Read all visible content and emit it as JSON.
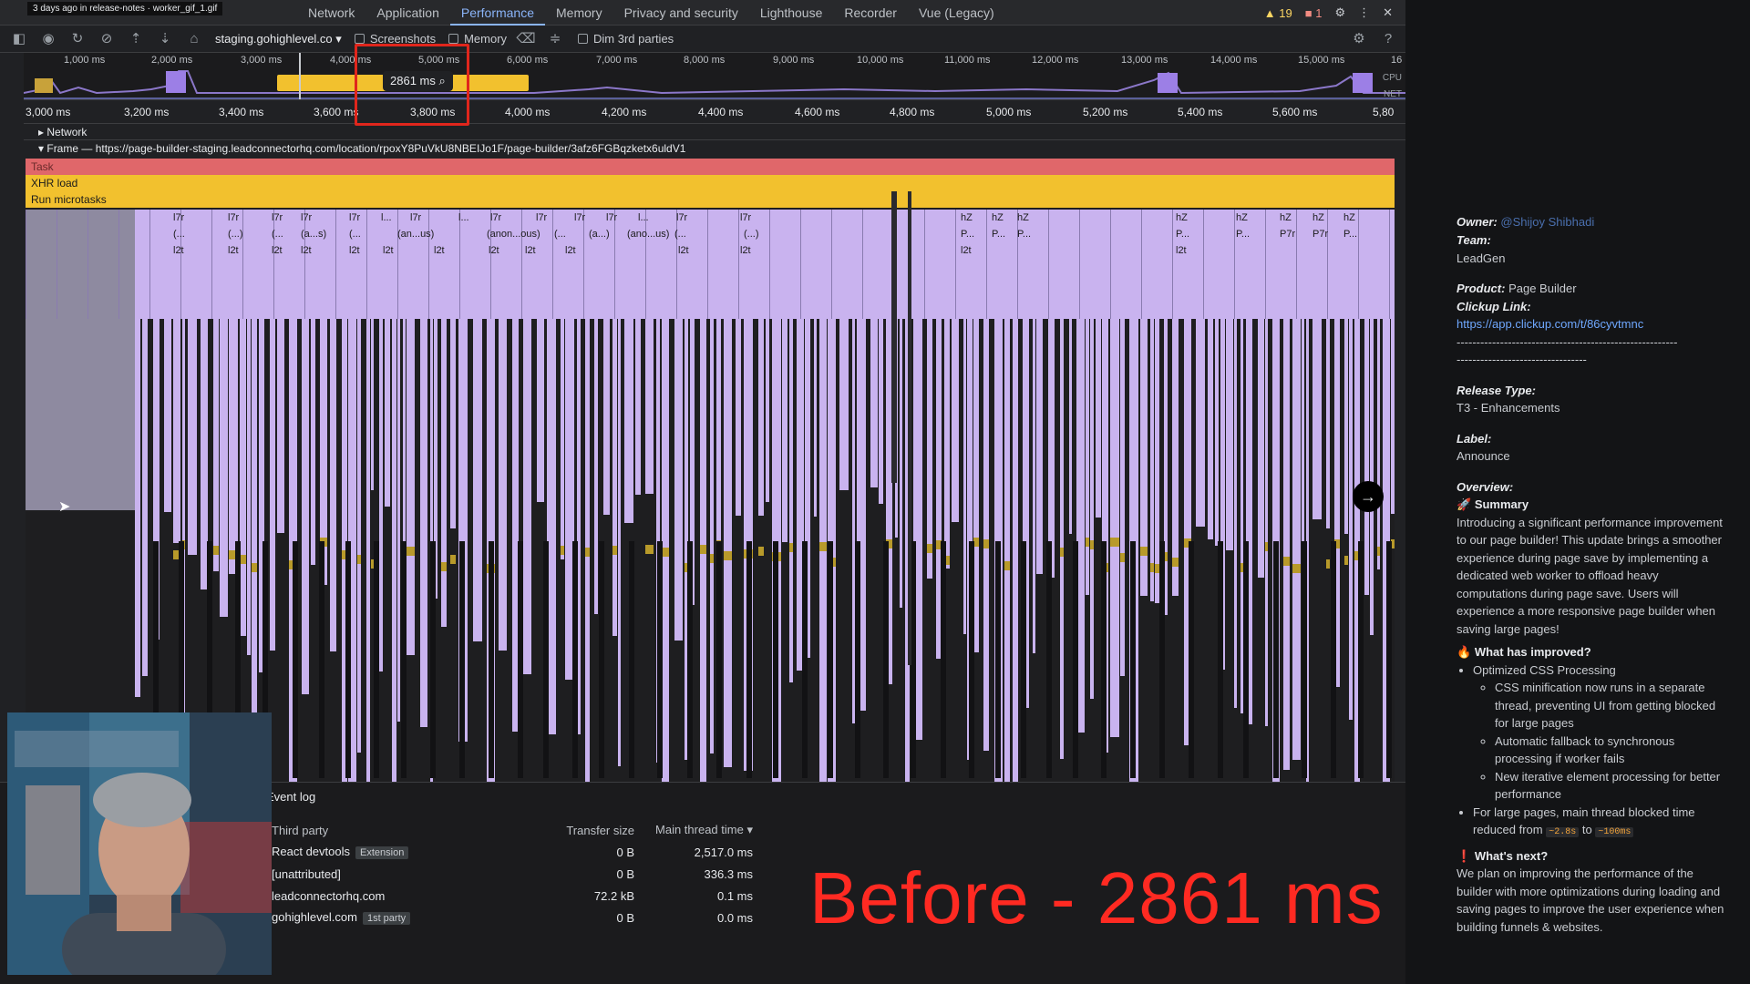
{
  "tabbar": {
    "ghost_label": "3 days ago in release-notes · worker_gif_1.gif",
    "tabs": [
      "Network",
      "Application",
      "Performance",
      "Memory",
      "Privacy and security",
      "Lighthouse",
      "Recorder",
      "Vue (Legacy)"
    ],
    "active_tab": "Performance",
    "warnings": "19",
    "errors": "1"
  },
  "toolbar": {
    "url": "staging.gohighlevel.co",
    "screenshots_label": "Screenshots",
    "memory_label": "Memory",
    "dim_label": "Dim 3rd parties"
  },
  "overview": {
    "ticks": [
      "1,000 ms",
      "2,000 ms",
      "3,000 ms",
      "4,000 ms",
      "5,000 ms",
      "6,000 ms",
      "7,000 ms",
      "8,000 ms",
      "9,000 ms",
      "10,000 ms",
      "11,000 ms",
      "12,000 ms",
      "13,000 ms",
      "14,000 ms",
      "15,000 ms",
      "16"
    ],
    "selection_label": "2861 ms",
    "cpu_label": "CPU",
    "net_label": "NET"
  },
  "ruler": {
    "ticks": [
      "3,000 ms",
      "3,200 ms",
      "3,400 ms",
      "3,600 ms",
      "3,800 ms",
      "4,000 ms",
      "4,200 ms",
      "4,400 ms",
      "4,600 ms",
      "4,800 ms",
      "5,000 ms",
      "5,200 ms",
      "5,400 ms",
      "5,600 ms",
      "5,80"
    ]
  },
  "tracks": {
    "network_label": "Network",
    "frame_label": "Frame — https://page-builder-staging.leadconnectorhq.com/location/rpoxY8PuVkU8NBEIJo1F/page-builder/3afz6FGBqzketx6uldV1",
    "task_label": "Task",
    "xhr_label": "XHR load",
    "microtasks_label": "Run microtasks"
  },
  "flame_labels": {
    "row1": [
      "l7r",
      "l7r",
      "l7r",
      "l7r",
      "l7r",
      "l...",
      "l7r",
      "l...",
      "l7r",
      "l7r",
      "l7r",
      "l7r",
      "l...",
      "l7r",
      "l7r",
      "hZ",
      "hZ",
      "hZ",
      "hZ",
      "hZ",
      "hZ",
      "hZ",
      "hZ"
    ],
    "row2": [
      "(...",
      "(...)",
      "(...",
      "(a...s)",
      "(...",
      "(an...us)",
      "(anon...ous)",
      "(...",
      "(a...)",
      "(ano...us)",
      "(...",
      "(...)",
      "P...",
      "P...",
      "P...",
      "P...",
      "P...",
      "P7r",
      "P7r",
      "P..."
    ],
    "row3": [
      "l2t",
      "l2t",
      "l2t",
      "l2t",
      "l2t",
      "l2t",
      "l2t",
      "l2t",
      "l2t",
      "l2t",
      "l2t",
      "l2t",
      "l2t",
      "l2t"
    ]
  },
  "bottom": {
    "event_log": "Event log",
    "col_party": "Third party",
    "col_transfer": "Transfer size",
    "col_main": "Main thread time",
    "rows": [
      {
        "name": "React devtools",
        "tag": "Extension",
        "transfer": "0 B",
        "main": "2,517.0 ms"
      },
      {
        "name": "[unattributed]",
        "tag": "",
        "transfer": "0 B",
        "main": "336.3 ms"
      },
      {
        "name": "leadconnectorhq.com",
        "tag": "",
        "transfer": "72.2 kB",
        "main": "0.1 ms"
      },
      {
        "name": "gohighlevel.com",
        "tag": "1st party",
        "transfer": "0 B",
        "main": "0.0 ms"
      }
    ]
  },
  "overlay_title": "Before - 2861 ms",
  "notes": {
    "owner_label": "Owner:",
    "owner_value": "@Shijoy Shibhadi",
    "team_label": "Team:",
    "team_value": "LeadGen",
    "product_label": "Product:",
    "product_value": "Page Builder",
    "clickup_label": "Clickup Link:",
    "clickup_value": "https://app.clickup.com/t/86cyvtmnc",
    "rule1": "--------------------------------------------------------",
    "rule2": "---------------------------------",
    "release_label": "Release Type:",
    "release_value": "T3 - Enhancements",
    "label_label": "Label:",
    "label_value": "Announce",
    "overview_label": "Overview:",
    "summary_head": "Summary",
    "summary_text": "Introducing a significant performance improvement to our page builder! This update brings a smoother experience during page save by implementing a dedicated web worker to offload heavy computations during page save. Users will experience a more responsive page builder when saving large pages!",
    "improved_head": "What has improved?",
    "improved_item1": "Optimized CSS Processing",
    "sub1": "CSS minification now runs in a separate thread, preventing UI from getting blocked for large pages",
    "sub2": "Automatic fallback to synchronous processing if worker fails",
    "sub3": "New iterative element processing for better performance",
    "improved_item2_a": "For large pages, main thread blocked time reduced from",
    "from_value": "~2.8s",
    "to_word": "to",
    "to_value": "~100ms",
    "next_head": "What's next?",
    "next_text": "We plan on improving the performance of the builder with more optimizations during loading and saving pages to improve the user experience when building funnels & websites."
  },
  "colors": {
    "flame_purple": "#c9b3ef",
    "task_red": "#e0676a",
    "xhr_yellow": "#f2c12e",
    "overlay_red": "#ff2a22"
  }
}
